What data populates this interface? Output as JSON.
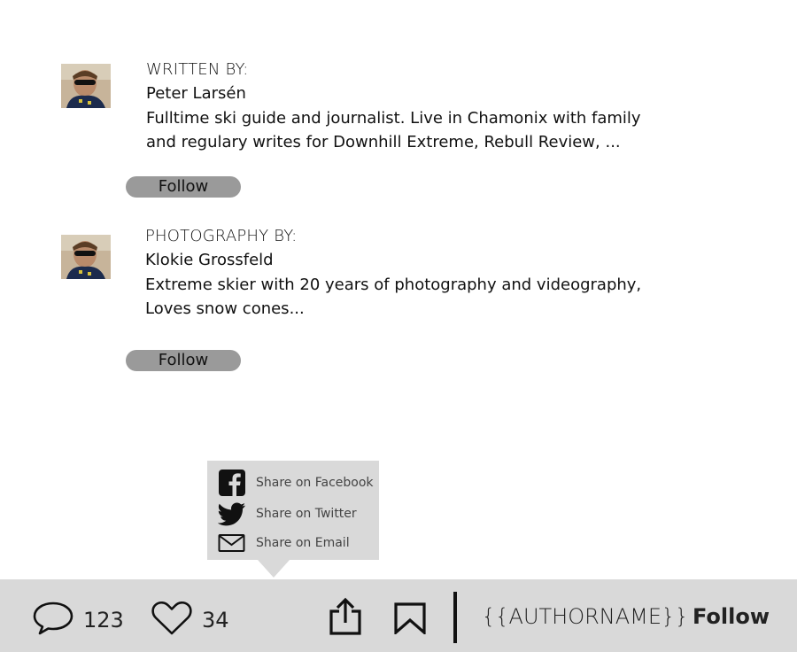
{
  "authors": [
    {
      "role": "WRITTEN BY:",
      "name": "Peter Larsén",
      "bio_line1": "Fulltime ski guide and journalist. Live in Chamonix with family",
      "bio_line2": "and regulary writes for Downhill Extreme, Rebull Review, ...",
      "follow_label": "Follow"
    },
    {
      "role": "PHOTOGRAPHY BY:",
      "name": "Klokie Grossfeld",
      "bio_line1": "Extreme skier with 20 years of photography and videography,",
      "bio_line2": "Loves snow cones...",
      "follow_label": "Follow"
    }
  ],
  "share_menu": {
    "items": [
      {
        "icon": "facebook-icon",
        "label": "Share on Facebook"
      },
      {
        "icon": "twitter-icon",
        "label": "Share on Twitter"
      },
      {
        "icon": "email-icon",
        "label": "Share on Email"
      }
    ]
  },
  "bottom_bar": {
    "comments_icon": "comment-icon",
    "comments_count": "123",
    "likes_icon": "heart-icon",
    "likes_count": "34",
    "share_icon": "share-icon",
    "bookmark_icon": "bookmark-icon",
    "author_placeholder": "{{AUTHORNAME}}",
    "follow_label": "Follow"
  },
  "colors": {
    "bar_background": "#d9d9d9",
    "follow_pill": "#9a9a9a",
    "text": "#111111"
  }
}
